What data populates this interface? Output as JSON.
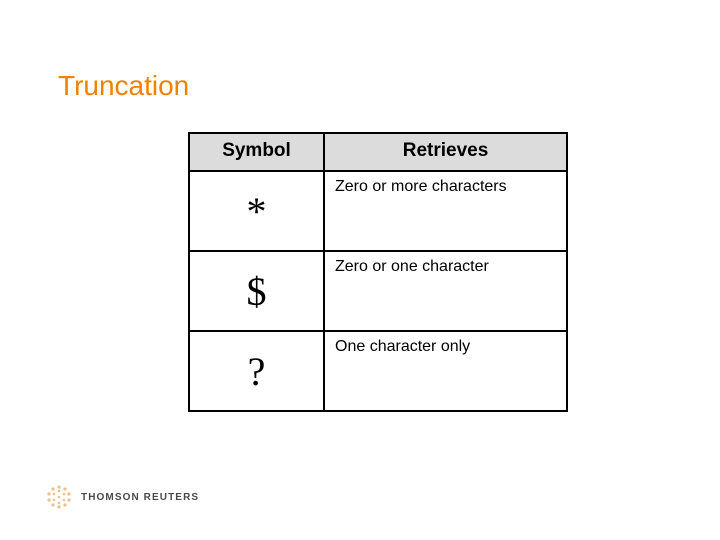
{
  "title": "Truncation",
  "table": {
    "headers": {
      "symbol": "Symbol",
      "retrieves": "Retrieves"
    },
    "rows": [
      {
        "symbol": "*",
        "desc": "Zero or more characters"
      },
      {
        "symbol": "$",
        "desc": "Zero or one character"
      },
      {
        "symbol": "?",
        "desc": "One character only"
      }
    ]
  },
  "footer": {
    "brand": "THOMSON REUTERS"
  },
  "chart_data": {
    "type": "table",
    "title": "Truncation",
    "columns": [
      "Symbol",
      "Retrieves"
    ],
    "rows": [
      [
        "*",
        "Zero or more characters"
      ],
      [
        "$",
        "Zero or one character"
      ],
      [
        "?",
        "One character only"
      ]
    ]
  }
}
